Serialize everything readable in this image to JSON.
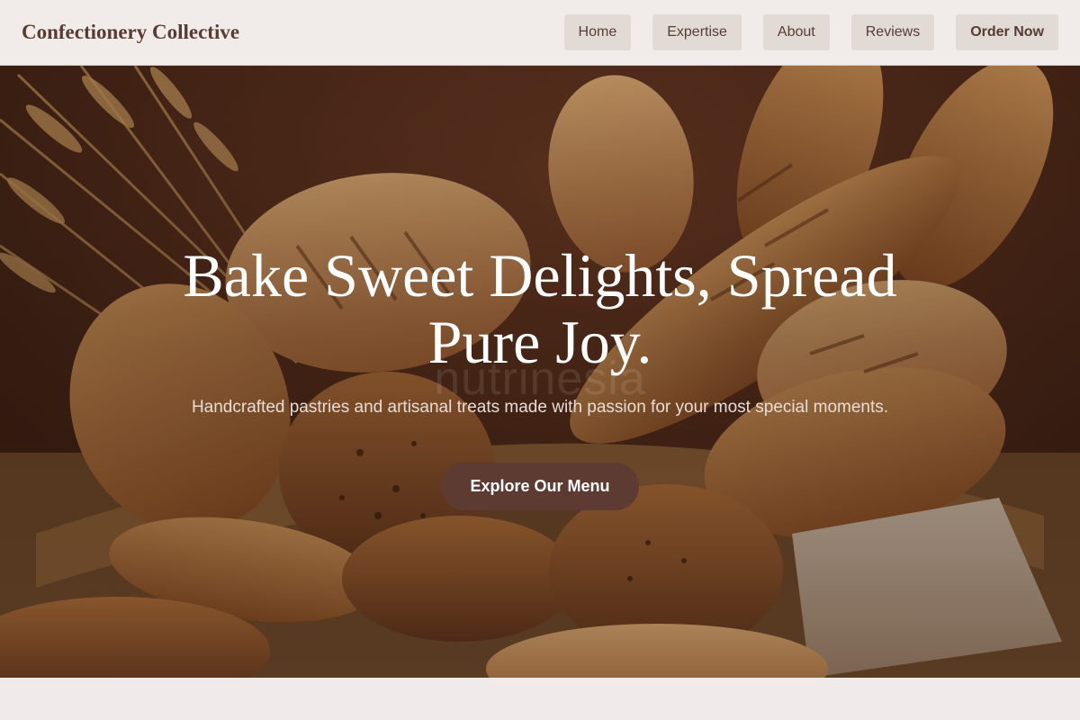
{
  "header": {
    "brand": "Confectionery Collective",
    "nav": [
      {
        "label": "Home"
      },
      {
        "label": "Expertise"
      },
      {
        "label": "About"
      },
      {
        "label": "Reviews"
      },
      {
        "label": "Order Now"
      }
    ]
  },
  "hero": {
    "title_line1": "Bake Sweet Delights, Spread",
    "title_line2": "Pure Joy.",
    "subtitle": "Handcrafted pastries and artisanal treats made with passion for your most special moments.",
    "cta_label": "Explore Our Menu",
    "watermark": "nutrinesia",
    "background_image": "bread-basket-photo"
  },
  "colors": {
    "brand": "#5a3b34",
    "nav_bg": "#e2dad4",
    "cta_bg": "#5e3b32",
    "page_bg": "#f1eaea"
  }
}
